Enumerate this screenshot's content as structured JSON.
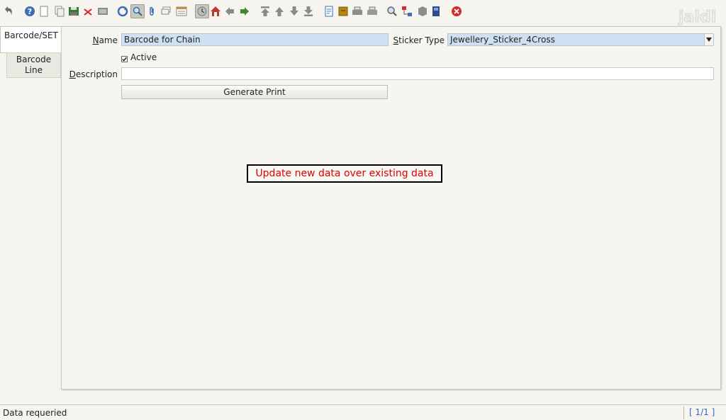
{
  "toolbar": {
    "icons": [
      "undo-icon",
      "help-icon",
      "new-record-icon",
      "copy-record-icon",
      "save-icon",
      "delete-icon",
      "print-preview-icon",
      "refresh-icon",
      "find-icon",
      "attachment-icon",
      "chat-icon",
      "grid-toggle-icon",
      "history-icon",
      "home-icon",
      "previous-icon",
      "next-icon",
      "first-record-icon",
      "previous-record-icon",
      "next-record-icon",
      "last-record-icon",
      "report-icon",
      "archive-icon",
      "print-icon",
      "print-alt-icon",
      "zoom-across-icon",
      "workflow-icon",
      "product-info-icon",
      "request-icon",
      "close-window-icon"
    ],
    "pressed": [
      "find-icon",
      "history-icon"
    ],
    "colors": {
      "accent_blue": "#3d6eb5",
      "close_red": "#d9262a",
      "arrow_green": "#3c8c2e",
      "home_red": "#c0392b"
    }
  },
  "brand": {
    "logo_text": "jaldi"
  },
  "tabs": [
    {
      "label": "Barcode/SET",
      "active": true
    },
    {
      "label": "Barcode Line",
      "line1": "Barcode",
      "line2": "Line",
      "active": false
    }
  ],
  "form": {
    "name": {
      "label_first": "N",
      "label_rest": "ame",
      "value": "Barcode for Chain"
    },
    "sticker_type": {
      "label_first": "S",
      "label_rest": "ticker Type",
      "value": "Jewellery_Sticker_4Cross"
    },
    "active": {
      "label": "Active",
      "checked": true
    },
    "description": {
      "label_first": "D",
      "label_rest": "escription",
      "value": ""
    },
    "generate_button": "Generate Print"
  },
  "popup": {
    "message": "Update new data over existing data"
  },
  "status": {
    "message": "Data requeried",
    "record_count": "[ 1/1 ]"
  },
  "colors": {
    "field_highlight": "#cfe0f2",
    "popup_text": "#e00000",
    "count_text": "#3366cc"
  }
}
